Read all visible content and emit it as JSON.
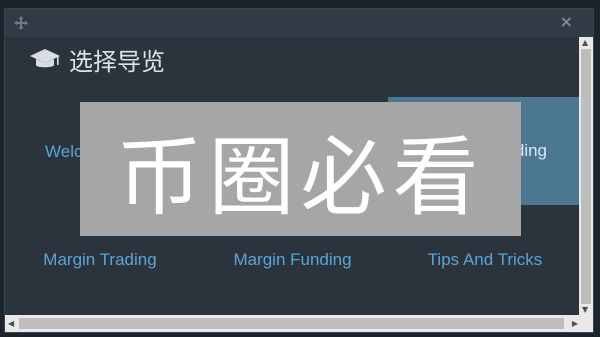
{
  "dialog": {
    "title": "选择导览",
    "close_symbol": "×"
  },
  "menu": {
    "items": [
      {
        "label": "Welc",
        "active": false
      },
      {
        "label": "ding",
        "active": true
      },
      {
        "label": "Margin Trading",
        "active": false
      },
      {
        "label": "Margin Funding",
        "active": false
      },
      {
        "label": "Tips And Tricks",
        "active": false
      }
    ]
  },
  "watermark": {
    "text": "币圈必看"
  },
  "icons": {
    "move": "move-icon",
    "close": "close-icon",
    "title": "graduation-cap-icon"
  },
  "colors": {
    "background": "#2b333c",
    "link": "#5aa5d6",
    "active_tile": "#4c7792",
    "watermark": "#a6a6a6"
  }
}
